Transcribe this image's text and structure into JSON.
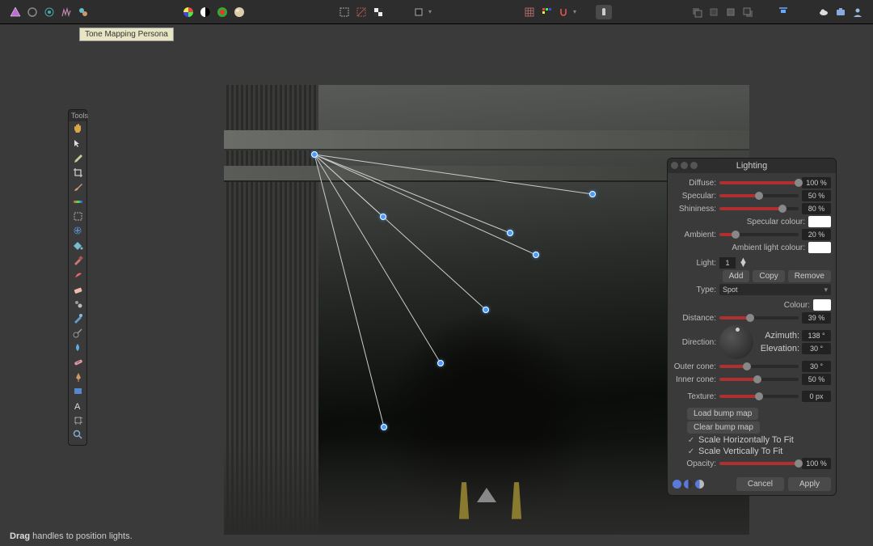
{
  "tooltip": "Tone Mapping Persona",
  "tools_header": "Tools",
  "panel": {
    "title": "Lighting",
    "diffuse": {
      "label": "Diffuse:",
      "value": "100 %",
      "pct": 100
    },
    "specular": {
      "label": "Specular:",
      "value": "50 %",
      "pct": 50
    },
    "shininess": {
      "label": "Shininess:",
      "value": "80 %",
      "pct": 80
    },
    "specular_colour": "Specular colour:",
    "ambient": {
      "label": "Ambient:",
      "value": "20 %",
      "pct": 20
    },
    "ambient_colour": "Ambient light colour:",
    "light_label": "Light:",
    "light_value": "1",
    "add": "Add",
    "copy": "Copy",
    "remove": "Remove",
    "type_label": "Type:",
    "type_value": "Spot",
    "colour_label": "Colour:",
    "distance": {
      "label": "Distance:",
      "value": "39 %",
      "pct": 39
    },
    "direction_label": "Direction:",
    "azimuth_label": "Azimuth:",
    "azimuth_value": "138 °",
    "elevation_label": "Elevation:",
    "elevation_value": "30 °",
    "outer": {
      "label": "Outer cone:",
      "value": "30 °",
      "pct": 35
    },
    "inner": {
      "label": "Inner cone:",
      "value": "50 %",
      "pct": 48
    },
    "texture": {
      "label": "Texture:",
      "value": "0 px",
      "pct": 50
    },
    "load_bump": "Load bump map",
    "clear_bump": "Clear bump map",
    "scale_h": "Scale Horizontally To Fit",
    "scale_v": "Scale Vertically To Fit",
    "opacity": {
      "label": "Opacity:",
      "value": "100 %",
      "pct": 100
    },
    "cancel": "Cancel",
    "apply": "Apply"
  },
  "status_bold": "Drag",
  "status_text": " handles to position lights."
}
